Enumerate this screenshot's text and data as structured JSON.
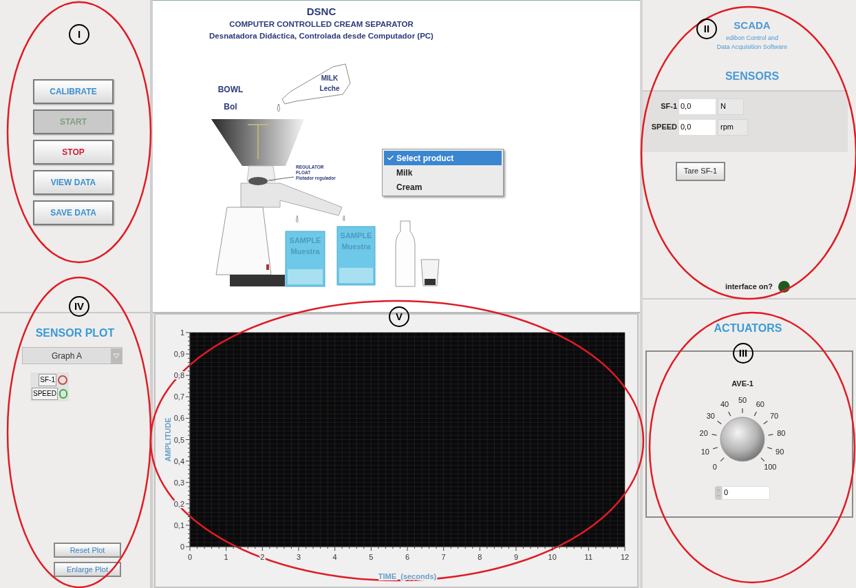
{
  "controls": {
    "buttons": [
      {
        "label": "CALIBRATE",
        "disabled": false,
        "color": "#3a8fd0"
      },
      {
        "label": "START",
        "disabled": true,
        "color": "#7f9f7f"
      },
      {
        "label": "STOP",
        "disabled": false,
        "color": "#d0203a"
      },
      {
        "label": "VIEW DATA",
        "disabled": false,
        "color": "#3a8fd0"
      },
      {
        "label": "SAVE DATA",
        "disabled": false,
        "color": "#3a8fd0"
      }
    ]
  },
  "diagram": {
    "title": [
      "DSNC",
      "COMPUTER CONTROLLED CREAM SEPARATOR",
      "Desnatadora Didáctica, Controlada desde Computador (PC)"
    ],
    "bowl_label": [
      "BOWL",
      "Bol"
    ],
    "milk_label": [
      "MILK",
      "Leche"
    ],
    "float_label": [
      "REGULATOR",
      "FLOAT",
      "Flotador regulador"
    ],
    "samples": [
      {
        "lines": [
          "SAMPLE",
          "Muestra"
        ]
      },
      {
        "lines": [
          "SAMPLE",
          "Muestra"
        ]
      }
    ]
  },
  "product_menu": {
    "items": [
      {
        "label": "Select product",
        "checked": true,
        "selected": true
      },
      {
        "label": "Milk",
        "checked": false,
        "selected": false
      },
      {
        "label": "Cream",
        "checked": false,
        "selected": false
      }
    ]
  },
  "scada": {
    "title": "SCADA",
    "subtitle": [
      "edibon Control and",
      "Data Acquisition Software"
    ]
  },
  "sensors": {
    "title": "SENSORS",
    "rows": [
      {
        "label": "SF-1",
        "value": "0,0",
        "unit": "N"
      },
      {
        "label": "SPEED",
        "value": "0,0",
        "unit": "rpm"
      }
    ],
    "tare_button": "Tare SF-1",
    "interface": {
      "label": "interface on?",
      "on": false
    }
  },
  "actuators": {
    "title": "ACTUATORS",
    "knob": {
      "label": "AVE-1",
      "scale": [
        "0",
        "10",
        "20",
        "30",
        "40",
        "50",
        "60",
        "70",
        "80",
        "90",
        "100"
      ],
      "value": "0"
    }
  },
  "sensor_plot": {
    "title": "SENSOR PLOT",
    "graph_select": "Graph A",
    "legend": [
      {
        "label": "SF-1",
        "color": "#d04848"
      },
      {
        "label": "SPEED",
        "color": "#30b040"
      }
    ],
    "buttons": [
      "Reset Plot",
      "Enlarge Plot"
    ]
  },
  "plot": {
    "chart_data": {
      "type": "line",
      "grid": true,
      "xlabel": "TIME  (seconds)",
      "ylabel": "AMPLITUDE",
      "xlim": [
        0,
        12
      ],
      "ylim": [
        0,
        1
      ],
      "xticks": [
        0,
        1,
        2,
        3,
        4,
        5,
        6,
        7,
        8,
        9,
        10,
        11,
        12
      ],
      "yticks": [
        {
          "value": 0,
          "label": "0"
        },
        {
          "value": 0.1,
          "label": "0,1"
        },
        {
          "value": 0.2,
          "label": "0,2"
        },
        {
          "value": 0.3,
          "label": "0,3"
        },
        {
          "value": 0.4,
          "label": "0,4"
        },
        {
          "value": 0.5,
          "label": "0,5"
        },
        {
          "value": 0.6,
          "label": "0,6"
        },
        {
          "value": 0.7,
          "label": "0,7"
        },
        {
          "value": 0.8,
          "label": "0,8"
        },
        {
          "value": 0.9,
          "label": "0,9"
        },
        {
          "value": 1,
          "label": "1"
        }
      ]
    }
  },
  "annotations": [
    {
      "label": "I"
    },
    {
      "label": "II"
    },
    {
      "label": "III"
    },
    {
      "label": "IV"
    },
    {
      "label": "V"
    }
  ]
}
